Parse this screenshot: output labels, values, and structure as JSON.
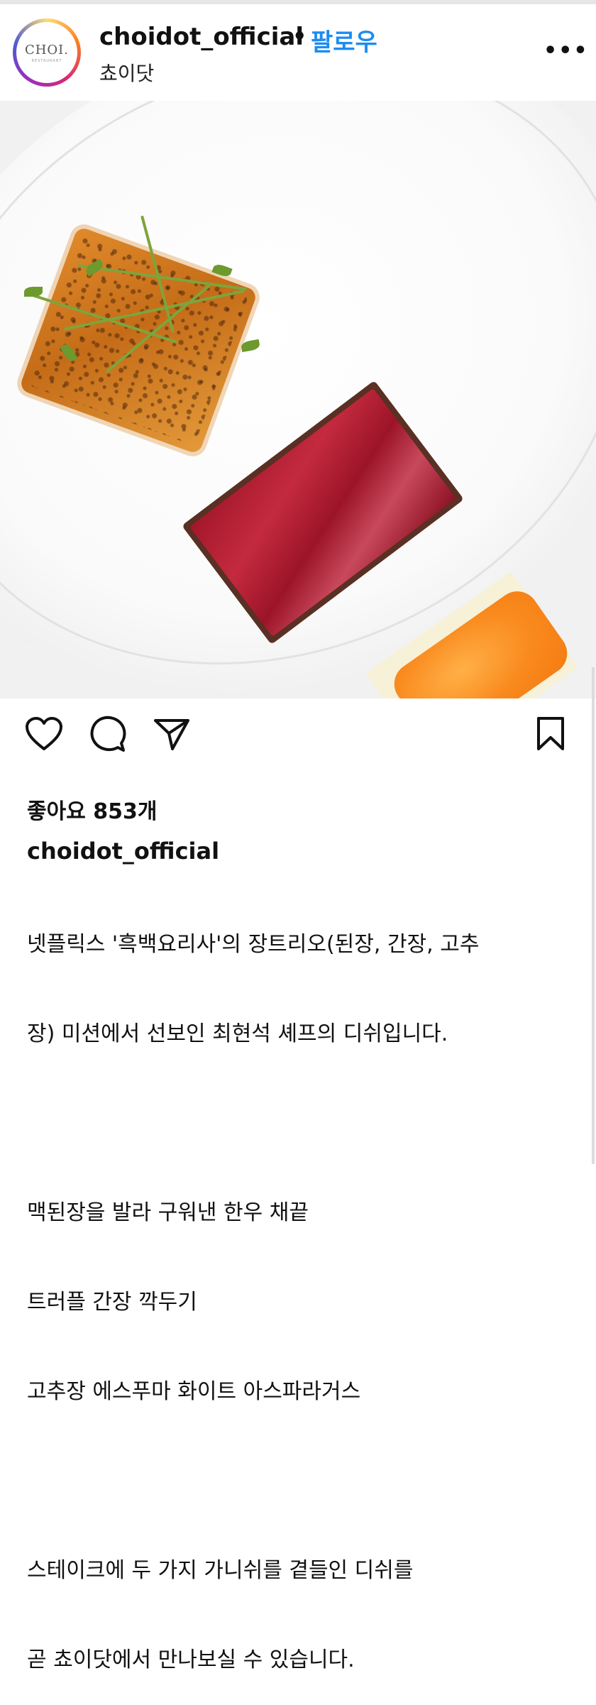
{
  "post": {
    "header": {
      "username": "choidot_official",
      "separator": "•",
      "follow_label": "팔로우",
      "subtitle": "쵸이닷",
      "more_label": "•••",
      "avatar_logo": "CHOI",
      "avatar_logo_dot": ".",
      "avatar_sub": "RESTAURANT"
    },
    "image": {
      "description_icon": "food-photo",
      "tag_icon": "person-icon"
    },
    "actions": {
      "like_icon": "heart-icon",
      "comment_icon": "comment-icon",
      "share_icon": "send-icon",
      "save_icon": "bookmark-icon"
    },
    "likes_text": "좋아요 853개",
    "caption": {
      "username": "choidot_official",
      "lines": [
        "넷플릭스 '흑백요리사'의 장트리오(된장, 간장, 고추",
        "장) 미션에서 선보인 최현석 셰프의 디쉬입니다.",
        "",
        "맥된장을 발라 구워낸 한우 채끝",
        "트러플 간장 깍두기",
        "고추장 에스푸마 화이트 아스파라거스",
        "",
        "스테이크에 두 가지 가니쉬를 곁들인 디쉬를",
        "곧 쵸이닷에서 만나보실 수 있습니다."
      ]
    },
    "colors": {
      "follow_blue": "#1d8cf0",
      "text": "#111111"
    }
  }
}
